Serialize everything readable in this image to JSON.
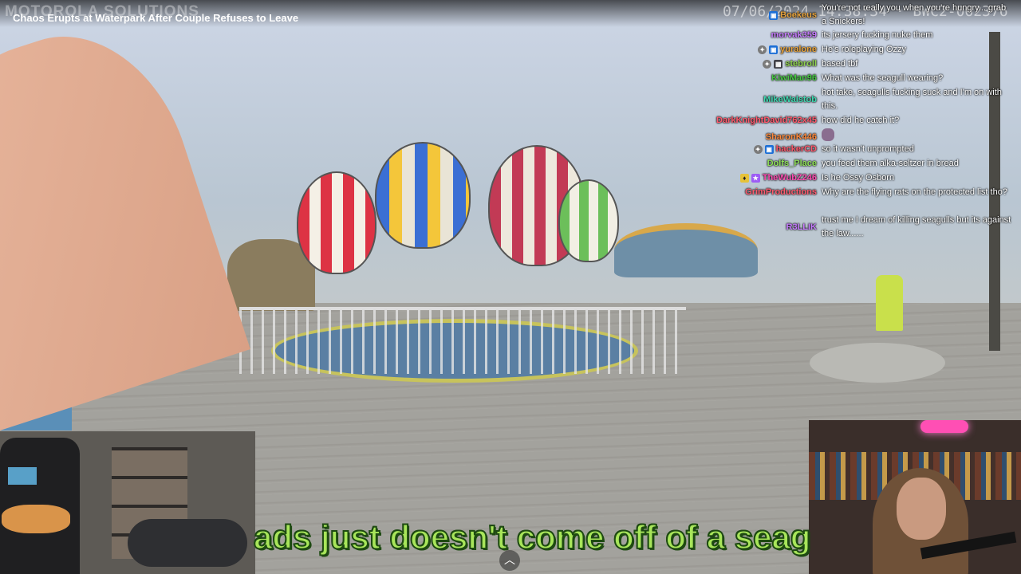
{
  "video": {
    "title": "Chaos Erupts at Waterpark After Couple Refuses to Leave",
    "watermark": "MOTOROLA SOLUTIONS",
    "timestamp": "07/06/2024 14:38:34 · BWC2-062376",
    "caption": "ads just doesn't come off of a seagull"
  },
  "chat": {
    "messages": [
      {
        "user": "Boekeus",
        "color": "#e6a23c",
        "badges": [
          "tv"
        ],
        "text": "You're not really you when you're hungry... grab a Snickers!"
      },
      {
        "user": "morvak359",
        "color": "#c77dff",
        "badges": [],
        "text": "its jersery fucking nuke them"
      },
      {
        "user": "yuralone",
        "color": "#e6a23c",
        "badges": [
          "mod",
          "tv"
        ],
        "text": "He's roleplaying Ozzy"
      },
      {
        "user": "stebroll",
        "color": "#8fd14f",
        "badges": [
          "mod",
          "game"
        ],
        "text": "based tbf"
      },
      {
        "user": "KiwiMan96",
        "color": "#47c742",
        "badges": [],
        "text": "What was the seagull wearing?"
      },
      {
        "user": "MikeWalstob",
        "color": "#3fd7b0",
        "badges": [],
        "text": "hot take, seagulls fucking suck and I'm on with this."
      },
      {
        "user": "DarkKnightDavid762x45",
        "color": "#ff5a6e",
        "badges": [],
        "text": "how did he catch it?"
      },
      {
        "user": "SharonK446",
        "color": "#ff8a3d",
        "badges": [],
        "text": "",
        "emote": "emote"
      },
      {
        "user": "hackerCD",
        "color": "#ff5a6e",
        "badges": [
          "mod",
          "tv"
        ],
        "text": "so it wasn't unprompted"
      },
      {
        "user": "Dolfs_Place",
        "color": "#8fe05a",
        "badges": [],
        "text": "you feed them alka-seltzer in bread"
      },
      {
        "user": "TheWubZ246",
        "color": "#ff4fb4",
        "badges": [
          "bits",
          "sub"
        ],
        "text": "Is he Ossy Osborn"
      },
      {
        "user": "GrimProductions",
        "color": "#ff5a6e",
        "badges": [],
        "text": "Why are the flying rats on the protected list tho?"
      },
      {
        "user": "R3LLIK",
        "color": "#c77dff",
        "badges": [],
        "text": "trust me I dream of killing seagulls but its against the law......"
      }
    ]
  },
  "controls": {
    "expand_icon": "︿"
  }
}
